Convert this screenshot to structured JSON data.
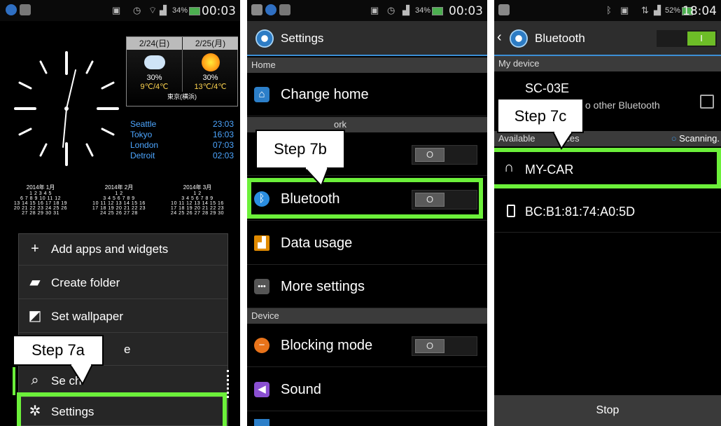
{
  "panel1": {
    "status": {
      "battery": "34%",
      "time": "00:03"
    },
    "weather": {
      "days": [
        {
          "date": "2/24(日)",
          "rain": "30%",
          "temp": "9℃/4℃",
          "icon": "cloud-icon"
        },
        {
          "date": "2/25(月)",
          "rain": "30%",
          "temp": "13℃/4℃",
          "icon": "sun-icon"
        }
      ],
      "location": "東京(横浜)"
    },
    "cities": [
      {
        "name": "Seattle",
        "time": "23:03"
      },
      {
        "name": "Tokyo",
        "time": "16:03"
      },
      {
        "name": "London",
        "time": "07:03"
      },
      {
        "name": "Detroit",
        "time": "02:03"
      }
    ],
    "calendars": [
      {
        "title": "2014年 1月",
        "weeks": [
          "1 2 3 4 5",
          "6 7 8 9 10 11 12",
          "13 14 15 16 17 18 19",
          "20 21 22 23 24 25 26",
          "27 28 29 30 31"
        ]
      },
      {
        "title": "2014年 2月",
        "weeks": [
          "1 2",
          "3 4 5 6 7 8 9",
          "10 11 12 13 14 15 16",
          "17 18 19 20 21 22 23",
          "24 25 26 27 28"
        ]
      },
      {
        "title": "2014年 3月",
        "weeks": [
          "1 2",
          "3 4 5 6 7 8 9",
          "10 11 12 13 14 15 16",
          "17 18 19 20 21 22 23",
          "24 25 26 27 28 29 30"
        ]
      }
    ],
    "menu": [
      {
        "label": "Add apps and widgets",
        "icon": "plus-icon"
      },
      {
        "label": "Create folder",
        "icon": "folder-icon"
      },
      {
        "label": "Set wallpaper",
        "icon": "wallpaper-icon"
      },
      {
        "label": "e",
        "icon": "edit-icon"
      },
      {
        "label": "Se  ch",
        "icon": "search-icon"
      },
      {
        "label": "Settings",
        "icon": "gear-icon"
      }
    ],
    "callout": "Step 7a"
  },
  "panel2": {
    "status": {
      "battery": "34%",
      "time": "00:03"
    },
    "title": "Settings",
    "sections": {
      "home": "Home",
      "wireless": "Wireless and network",
      "device": "Device"
    },
    "rows": {
      "change_home": "Change home",
      "bluetooth": "Bluetooth",
      "data_usage": "Data usage",
      "more_settings": "More settings",
      "blocking_mode": "Blocking mode",
      "sound": "Sound"
    },
    "toggle_off": "O",
    "callout": "Step 7b",
    "wireless_visible": "ork"
  },
  "panel3": {
    "status": {
      "battery": "52%",
      "time": "18:04"
    },
    "title": "Bluetooth",
    "toggle_on": "I",
    "my_device_header": "My device",
    "device_name": "SC-03E",
    "device_sub": "o other Bluetooth",
    "available_header_a": "Available",
    "available_header_b": "vices",
    "scanning": "Scanning.",
    "devices": [
      {
        "name": "MY-CAR",
        "icon": "headphones-icon"
      },
      {
        "name": "BC:B1:81:74:A0:5D",
        "icon": "phone-icon"
      }
    ],
    "stop_label": "Stop",
    "callout": "Step 7c"
  }
}
